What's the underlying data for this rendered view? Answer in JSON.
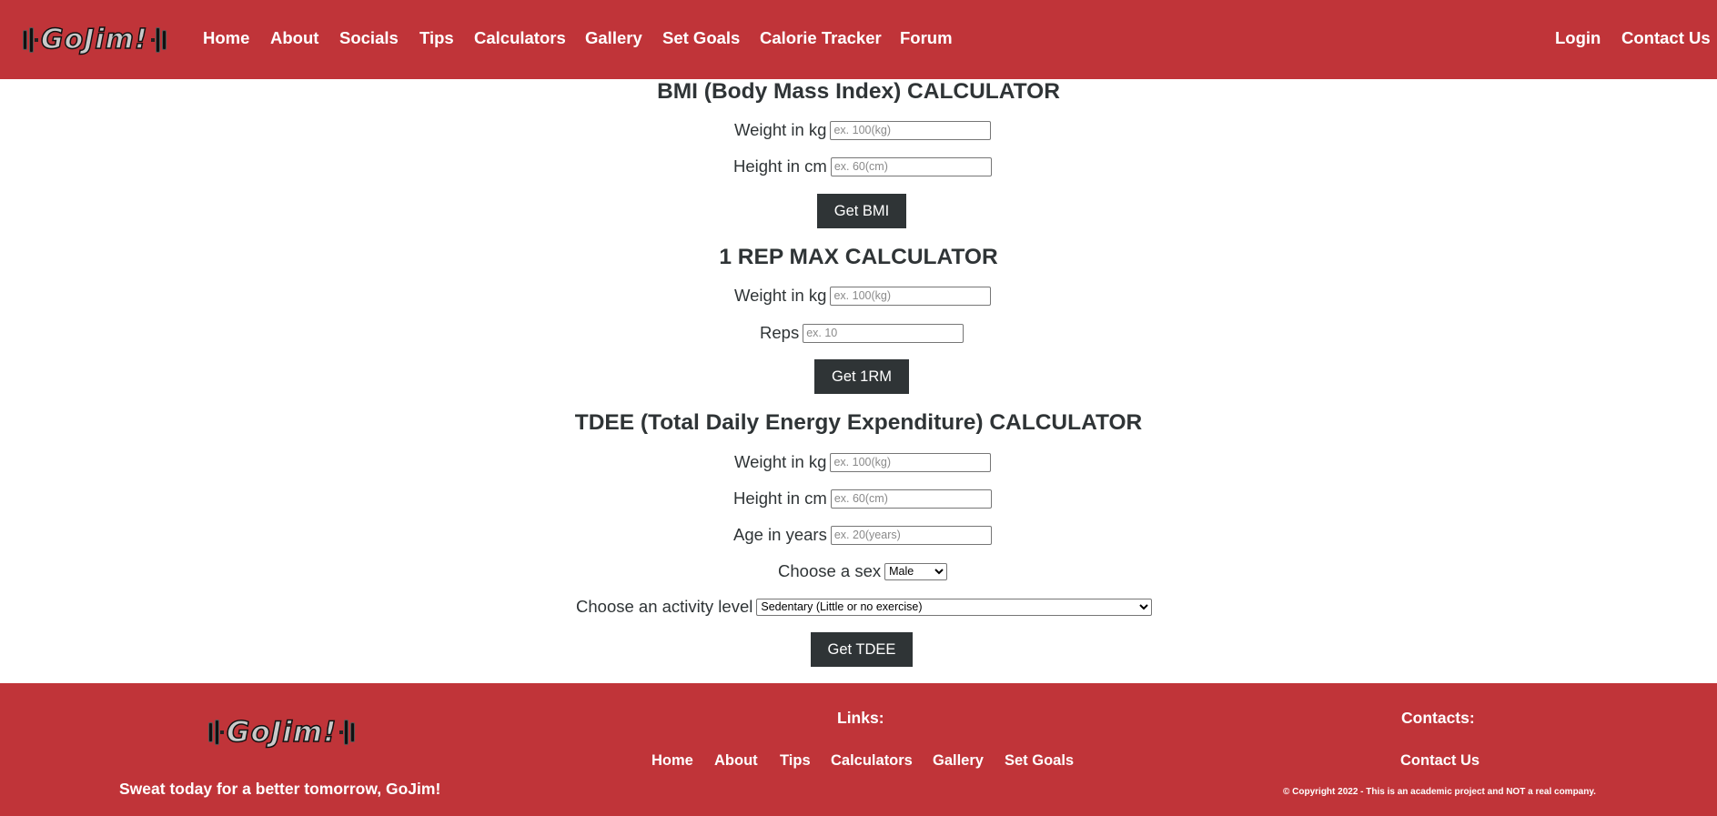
{
  "nav": {
    "logo_text": "GoJim!",
    "links": [
      "Home",
      "About",
      "Socials",
      "Tips",
      "Calculators",
      "Gallery",
      "Set Goals",
      "Calorie Tracker",
      "Forum"
    ],
    "right_links": [
      "Login",
      "Contact Us"
    ]
  },
  "bmi": {
    "title": "BMI (Body Mass Index) CALCULATOR",
    "weight_label": "Weight in kg",
    "weight_placeholder": "ex. 100(kg)",
    "height_label": "Height in cm",
    "height_placeholder": "ex. 60(cm)",
    "button": "Get BMI"
  },
  "rm": {
    "title": "1 REP MAX CALCULATOR",
    "weight_label": "Weight in kg",
    "weight_placeholder": "ex. 100(kg)",
    "reps_label": "Reps",
    "reps_placeholder": "ex. 10",
    "button": "Get 1RM"
  },
  "tdee": {
    "title": "TDEE (Total Daily Energy Expenditure) CALCULATOR",
    "weight_label": "Weight in kg",
    "weight_placeholder": "ex. 100(kg)",
    "height_label": "Height in cm",
    "height_placeholder": "ex. 60(cm)",
    "age_label": "Age in years",
    "age_placeholder": "ex. 20(years)",
    "sex_label": "Choose a sex",
    "sex_value": "Male",
    "activity_label": "Choose an activity level",
    "activity_value": "Sedentary (Little or no exercise)",
    "button": "Get TDEE"
  },
  "footer": {
    "logo_text": "GoJim!",
    "tagline": "Sweat today for a better tomorrow, GoJim!",
    "links_heading": "Links:",
    "links": [
      "Home",
      "About",
      "Tips",
      "Calculators",
      "Gallery",
      "Set Goals"
    ],
    "contacts_heading": "Contacts:",
    "contact_link": "Contact Us",
    "copyright": "© Copyright 2022 - This is an academic project and NOT a real company."
  },
  "colors": {
    "brand_red": "#c03439",
    "dark": "#2f3436",
    "text_light": "#ffffff"
  },
  "icons": {
    "logo": "barbell-logo-icon"
  }
}
